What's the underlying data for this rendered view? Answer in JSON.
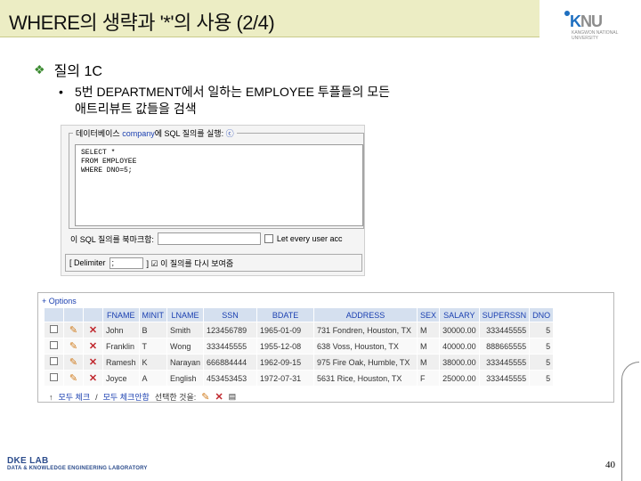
{
  "slide": {
    "title": "WHERE의 생략과 '*'의 사용 (2/4)",
    "logo": {
      "mark_k": "K",
      "mark_rest": "NU",
      "sub": "KANGWON NATIONAL UNIVERSITY"
    },
    "bullet1": "질의 1C",
    "bullet2_line1": "5번 DEPARTMENT에서 일하는 EMPLOYEE 투플들의 모든",
    "bullet2_line2": "애트리뷰트 값들을 검색",
    "bullet2_dot": "•",
    "diamond": "❖",
    "dke_title": "DKE LAB",
    "dke_sub": "DATA & KNOWLEDGE ENGINEERING LABORATORY",
    "page_number": "40"
  },
  "query_panel": {
    "legend_prefix": "데이터베이스",
    "legend_db": "company",
    "legend_suffix": "에 SQL 질의를 실행:",
    "legend_icon": "ⓒ",
    "sql": "SELECT *\nFROM EMPLOYEE\nWHERE DNO=5;",
    "bookmark_label": "이 SQL 질의를 북마크함:",
    "let_every_user": "Let every user acc",
    "delimiter_label": "[ Delimiter",
    "delimiter_value": ";",
    "show_again_label": "] ☑ 이 질의를 다시 보여줌"
  },
  "results": {
    "options_label": "+ Options",
    "columns": [
      "FNAME",
      "MINIT",
      "LNAME",
      "SSN",
      "BDATE",
      "ADDRESS",
      "SEX",
      "SALARY",
      "SUPERSSN",
      "DNO"
    ],
    "rows": [
      [
        "John",
        "B",
        "Smith",
        "123456789",
        "1965-01-09",
        "731 Fondren, Houston, TX",
        "M",
        "30000.00",
        "333445555",
        "5"
      ],
      [
        "Franklin",
        "T",
        "Wong",
        "333445555",
        "1955-12-08",
        "638 Voss, Houston, TX",
        "M",
        "40000.00",
        "888665555",
        "5"
      ],
      [
        "Ramesh",
        "K",
        "Narayan",
        "666884444",
        "1962-09-15",
        "975 Fire Oak, Humble, TX",
        "M",
        "38000.00",
        "333445555",
        "5"
      ],
      [
        "Joyce",
        "A",
        "English",
        "453453453",
        "1972-07-31",
        "5631 Rice, Houston, TX",
        "F",
        "25000.00",
        "333445555",
        "5"
      ]
    ],
    "footer_arrow": "↑",
    "footer_select_all": "모두 체크",
    "footer_sep": "/",
    "footer_unselect": "모두 체크안함",
    "footer_action": "선택한 것을:"
  }
}
